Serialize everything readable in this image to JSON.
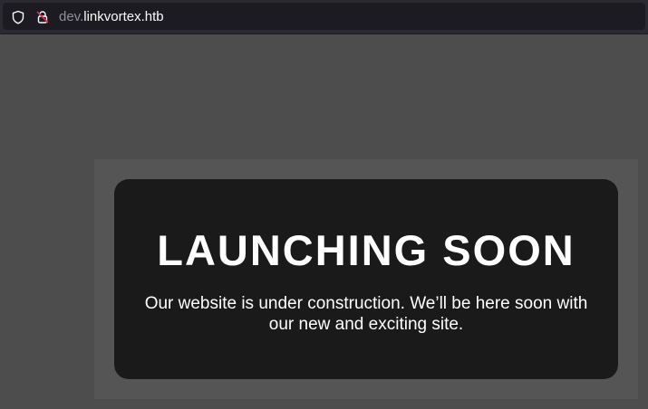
{
  "browser": {
    "url_subdomain": "dev.",
    "url_host": "linkvortex.htb",
    "icons": {
      "tracking": "shield-icon",
      "security": "lock-icon"
    }
  },
  "page": {
    "headline": "LAUNCHING SOON",
    "message": "Our website is under construction. We’ll be here soon with our new and exciting site."
  },
  "colors": {
    "page_background": "#4d4d4d",
    "panel_background": "#555555",
    "card_background": "#1a1a1a",
    "text": "#ffffff",
    "toolbar": "#2b2a33",
    "urlbar": "#1c1b22"
  }
}
